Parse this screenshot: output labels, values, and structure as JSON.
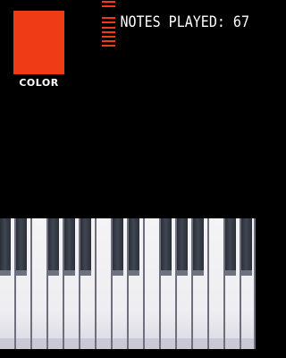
{
  "color_indicator": {
    "label": "COLOR",
    "color": "#f03c14"
  },
  "notes_played": {
    "label": "NOTES PLAYED: 67"
  },
  "level_meter": {
    "color": "#f03c14"
  },
  "keyboard": {
    "white_key_count": 16,
    "black_key_color": "#2f3540",
    "white_key_color": "#f2f2f4"
  }
}
